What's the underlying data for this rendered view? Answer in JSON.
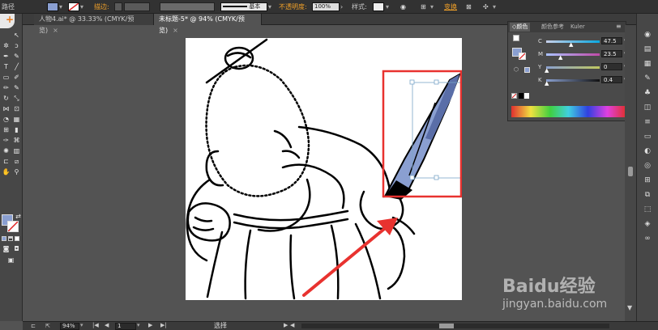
{
  "control_bar": {
    "object_label": "路径",
    "stroke_label": "描边:",
    "stroke_style": "基本",
    "opacity_label": "不透明度:",
    "opacity_value": "100%",
    "style_label": "样式:",
    "transform_link": "变换",
    "fill_color": "#8a9fd1",
    "accent_color": "#f0a028"
  },
  "tabs": [
    {
      "label": "人物4.ai* @ 33.33% (CMYK/预览)",
      "close": "×"
    },
    {
      "label": "未标题-5* @ 94% (CMYK/预览)",
      "close": "×"
    }
  ],
  "color_panel": {
    "tabs": [
      "颜色",
      "颜色参考",
      "Kuler"
    ],
    "channels": [
      {
        "label": "C",
        "value": "47.5",
        "unit": "%",
        "level": 0.475
      },
      {
        "label": "M",
        "value": "23.5",
        "unit": "%",
        "level": 0.235
      },
      {
        "label": "Y",
        "value": "0",
        "unit": "%",
        "level": 0
      },
      {
        "label": "K",
        "value": "0.4",
        "unit": "%",
        "level": 0.004
      }
    ],
    "current_color": "#8a9fd1"
  },
  "status_bar": {
    "zoom": "94%",
    "page": "1",
    "tool": "选择"
  },
  "watermark": {
    "brand": "Baidu经验",
    "url": "jingyan.baidu.com"
  },
  "annotation_color": "#e8322f"
}
